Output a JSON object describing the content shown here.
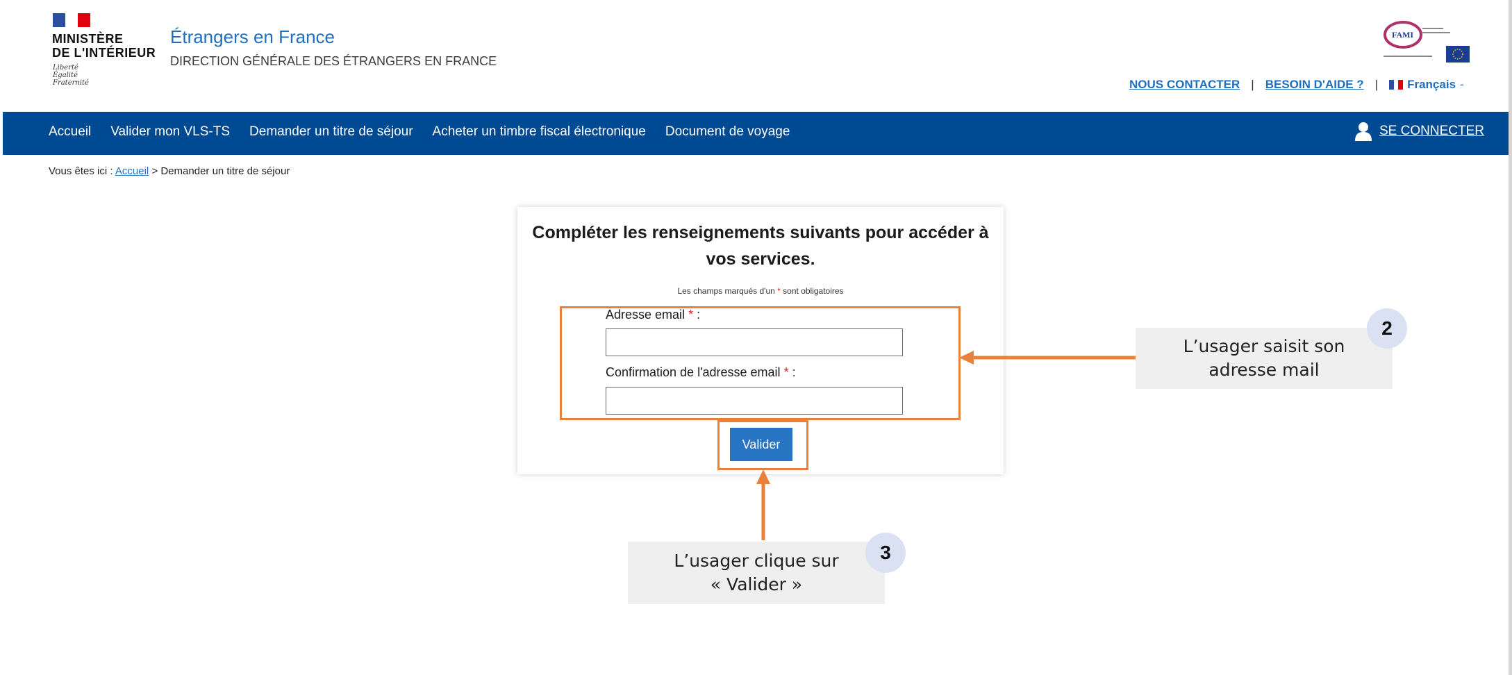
{
  "header": {
    "ministry_line1": "MINISTÈRE",
    "ministry_line2": "DE L'INTÉRIEUR",
    "motto": [
      "Liberté",
      "Égalité",
      "Fraternité"
    ],
    "site_title": "Étrangers en France",
    "site_subtitle": "DIRECTION GÉNÉRALE DES ÉTRANGERS EN FRANCE",
    "fami_logo_text": "FAMI",
    "links": {
      "contact": "NOUS CONTACTER",
      "help": "BESOIN D'AIDE ?",
      "separator": "|"
    },
    "language": "Français",
    "language_caret": "-"
  },
  "nav": {
    "items": [
      "Accueil",
      "Valider mon VLS-TS",
      "Demander un titre de séjour",
      "Acheter un timbre fiscal électronique",
      "Document de voyage"
    ],
    "login": "SE CONNECTER"
  },
  "breadcrumb": {
    "prefix": "Vous êtes ici :",
    "home": "Accueil",
    "separator": ">",
    "current": "Demander un titre de séjour"
  },
  "form": {
    "title": "Compléter les renseignements suivants pour accéder à vos services.",
    "required_note_before": "Les champs marqués d'un",
    "required_note_star": "*",
    "required_note_after": "sont obligatoires",
    "email_label": "Adresse email",
    "email_confirm_label": "Confirmation de l'adresse email",
    "required_star": "*",
    "label_suffix": ":",
    "email_value": "",
    "email_confirm_value": "",
    "submit_label": "Valider"
  },
  "annotations": {
    "step2": {
      "number": "2",
      "text_line1": "L’usager saisit son",
      "text_line2": "adresse mail"
    },
    "step3": {
      "number": "3",
      "text_line1": "L’usager clique sur",
      "text_line2": "« Valider »"
    }
  },
  "colors": {
    "nav_bg": "#004a93",
    "link": "#1f6fbf",
    "button": "#2774c2",
    "highlight": "#e8823a",
    "callout_bg": "#efefef",
    "badge_bg": "#d9e1f2"
  },
  "icons": {
    "user": "user-icon",
    "flag": "french-flag-icon"
  }
}
